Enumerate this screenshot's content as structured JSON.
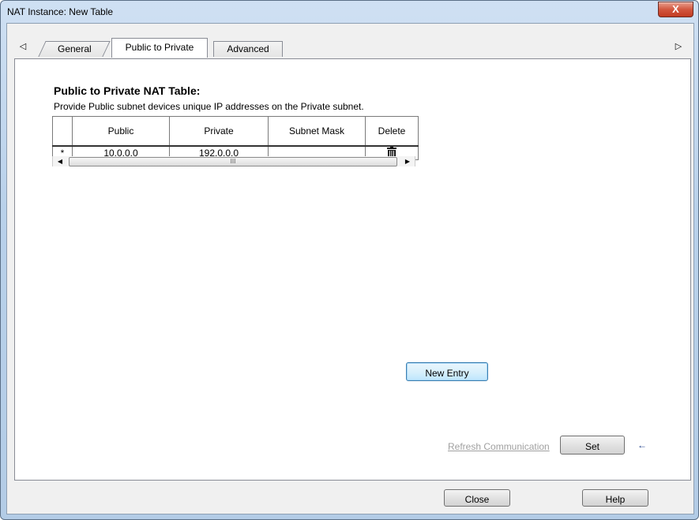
{
  "window": {
    "title": "NAT Instance: New Table",
    "close_glyph": "X"
  },
  "tabs": {
    "scroll_left": "◁",
    "scroll_right": "▷",
    "items": [
      {
        "label": "General"
      },
      {
        "label": "Public to Private"
      },
      {
        "label": "Advanced"
      }
    ]
  },
  "panel": {
    "heading": "Public to Private NAT Table:",
    "subtext": "Provide Public subnet devices unique IP addresses on the Private subnet.",
    "table": {
      "columns": [
        "Public",
        "Private",
        "Subnet Mask",
        "Delete"
      ],
      "rows": [
        {
          "marker": "*",
          "public": "10.0.0.0",
          "private": "192.0.0.0",
          "mask": "",
          "delete_icon": "trash-icon"
        }
      ]
    },
    "scrollbar": {
      "left": "◀",
      "right": "▶",
      "grip": "III"
    },
    "new_entry": "New Entry",
    "refresh": "Refresh Communication",
    "set": "Set",
    "set_arrow": "←"
  },
  "footer": {
    "close": "Close",
    "help": "Help"
  }
}
